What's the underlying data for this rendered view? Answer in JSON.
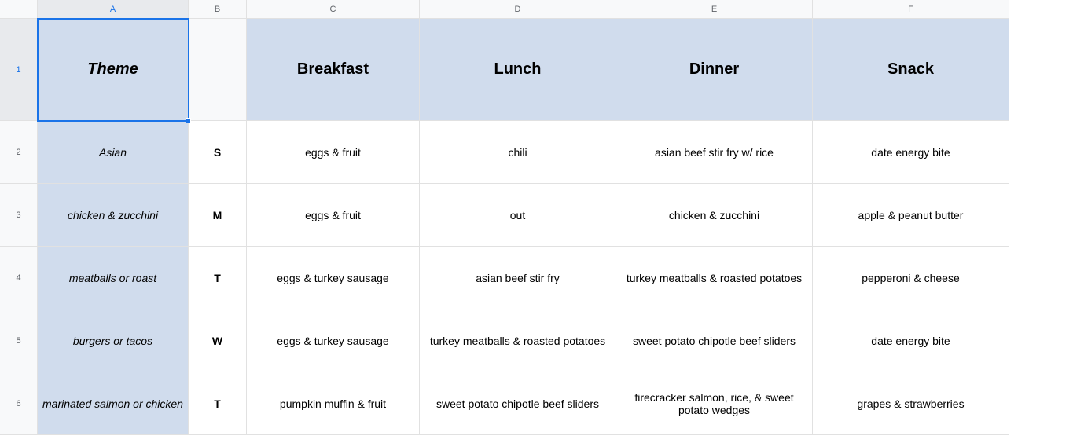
{
  "columns": [
    "A",
    "B",
    "C",
    "D",
    "E",
    "F"
  ],
  "rowNumbers": [
    "1",
    "2",
    "3",
    "4",
    "5",
    "6"
  ],
  "headers": {
    "theme": "Theme",
    "day": "",
    "breakfast": "Breakfast",
    "lunch": "Lunch",
    "dinner": "Dinner",
    "snack": "Snack"
  },
  "rows": [
    {
      "theme": "Asian",
      "day": "S",
      "breakfast": "eggs & fruit",
      "lunch": "chili",
      "dinner": "asian beef stir fry w/ rice",
      "snack": "date energy bite"
    },
    {
      "theme": "chicken & zucchini",
      "day": "M",
      "breakfast": "eggs & fruit",
      "lunch": "out",
      "dinner": "chicken & zucchini",
      "snack": "apple & peanut butter"
    },
    {
      "theme": "meatballs or roast",
      "day": "T",
      "breakfast": "eggs & turkey sausage",
      "lunch": "asian beef stir fry",
      "dinner": "turkey meatballs & roasted potatoes",
      "snack": "pepperoni & cheese"
    },
    {
      "theme": "burgers or tacos",
      "day": "W",
      "breakfast": "eggs & turkey sausage",
      "lunch": "turkey meatballs & roasted potatoes",
      "dinner": "sweet potato chipotle beef sliders",
      "snack": "date energy bite"
    },
    {
      "theme": "marinated salmon or chicken",
      "day": "T",
      "breakfast": "pumpkin muffin & fruit",
      "lunch": "sweet potato chipotle beef sliders",
      "dinner": "firecracker salmon, rice, & sweet potato wedges",
      "snack": "grapes & strawberries"
    }
  ],
  "selectedCell": "A1"
}
